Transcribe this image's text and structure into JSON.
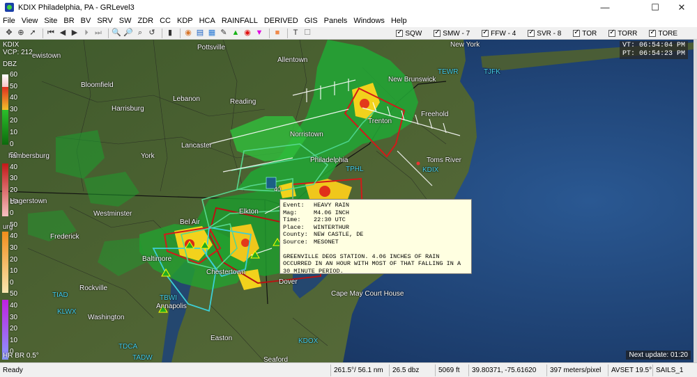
{
  "window": {
    "title": "KDIX Philadelphia, PA - GRLevel3",
    "minimize_glyph": "—",
    "maximize_glyph": "☐",
    "close_glyph": "✕"
  },
  "menu": [
    "File",
    "View",
    "Site",
    "BR",
    "BV",
    "SRV",
    "SW",
    "ZDR",
    "CC",
    "KDP",
    "HCA",
    "RAINFALL",
    "DERIVED",
    "GIS",
    "Panels",
    "Windows",
    "Help"
  ],
  "toolbar": {
    "warning_toggles": [
      {
        "label": "SQW",
        "checked": true
      },
      {
        "label": "SMW - 7",
        "checked": true
      },
      {
        "label": "FFW - 4",
        "checked": true
      },
      {
        "label": "SVR - 8",
        "checked": true
      },
      {
        "label": "TOR",
        "checked": true
      },
      {
        "label": "TORR",
        "checked": true
      },
      {
        "label": "TORE",
        "checked": true
      }
    ]
  },
  "radar": {
    "site": "KDIX",
    "vcp": "VCP: 212",
    "vt": "VT: 06:54:04 PM",
    "pt": "PT: 06:54:23 PM",
    "units": "DBZ",
    "product": "HR BR 0.5°",
    "next_update": "Next update: 01:20"
  },
  "legend_ticks": [
    "60",
    "50",
    "40",
    "30",
    "20",
    "10",
    "0",
    "50",
    "40",
    "30",
    "20",
    "10",
    "0",
    "50",
    "40",
    "30",
    "20",
    "10",
    "0",
    "50",
    "40",
    "30",
    "20",
    "10",
    "0",
    "50",
    "40",
    "30",
    "20",
    "10",
    "0"
  ],
  "map_labels": [
    {
      "text": "Pottsville",
      "cyan": false
    },
    {
      "text": "New York",
      "cyan": false
    },
    {
      "text": "ewistown",
      "cyan": false
    },
    {
      "text": "Allentown",
      "cyan": false
    },
    {
      "text": "New Brunswick",
      "cyan": false
    },
    {
      "text": "Bloomfield",
      "cyan": false
    },
    {
      "text": "TEWR",
      "cyan": true
    },
    {
      "text": "TJFK",
      "cyan": true
    },
    {
      "text": "Lebanon",
      "cyan": false
    },
    {
      "text": "Reading",
      "cyan": false
    },
    {
      "text": "Harrisburg",
      "cyan": false
    },
    {
      "text": "Freehold",
      "cyan": false
    },
    {
      "text": "Trenton",
      "cyan": false
    },
    {
      "text": "Norristown",
      "cyan": false
    },
    {
      "text": "Lancaster",
      "cyan": false
    },
    {
      "text": "hambersburg",
      "cyan": false
    },
    {
      "text": "York",
      "cyan": false
    },
    {
      "text": "Toms River",
      "cyan": false
    },
    {
      "text": "Philadelphia",
      "cyan": false
    },
    {
      "text": "TPHL",
      "cyan": true
    },
    {
      "text": "KDIX",
      "cyan": true
    },
    {
      "text": "Hagerstown",
      "cyan": false
    },
    {
      "text": "Westminster",
      "cyan": false
    },
    {
      "text": "Elkton",
      "cyan": false
    },
    {
      "text": "Bel Air",
      "cyan": false
    },
    {
      "text": "Frederick",
      "cyan": false
    },
    {
      "text": "Baltimore",
      "cyan": false
    },
    {
      "text": "Chestertown",
      "cyan": false
    },
    {
      "text": "Dover",
      "cyan": false
    },
    {
      "text": "Rockville",
      "cyan": false
    },
    {
      "text": "Cape May Court House",
      "cyan": false
    },
    {
      "text": "TIAD",
      "cyan": true
    },
    {
      "text": "TBWI",
      "cyan": true
    },
    {
      "text": "KLWX",
      "cyan": true
    },
    {
      "text": "Annapolis",
      "cyan": false
    },
    {
      "text": "Washington",
      "cyan": false
    },
    {
      "text": "TDCA",
      "cyan": true
    },
    {
      "text": "Easton",
      "cyan": false
    },
    {
      "text": "KDOX",
      "cyan": true
    },
    {
      "text": "TADW",
      "cyan": true
    },
    {
      "text": "Seaford",
      "cyan": false
    },
    {
      "text": "urg",
      "cyan": false
    }
  ],
  "marker_label": "40",
  "report": {
    "fields": [
      {
        "key": "Event:",
        "value": "HEAVY RAIN"
      },
      {
        "key": "Mag:",
        "value": "M4.06 INCH"
      },
      {
        "key": "Time:",
        "value": "22:30 UTC"
      },
      {
        "key": "Place:",
        "value": "WINTERTHUR"
      },
      {
        "key": "County:",
        "value": "NEW CASTLE, DE"
      },
      {
        "key": "Source:",
        "value": "MESONET"
      }
    ],
    "description": "GREENVILLE DEOS STATION. 4.06 INCHES OF RAIN OCCURRED IN AN HOUR WITH MOST OF THAT FALLING IN A 30 MINUTE PERIOD."
  },
  "status": {
    "state": "Ready",
    "azimuth_range": "261.5°/ 56.1 nm",
    "dbz": "26.5 dbz",
    "height": "5069 ft",
    "coords": "39.80371, -75.61620",
    "scale": "397 meters/pixel",
    "avset": "AVSET 19.5°",
    "sails": "SAILS_1"
  }
}
